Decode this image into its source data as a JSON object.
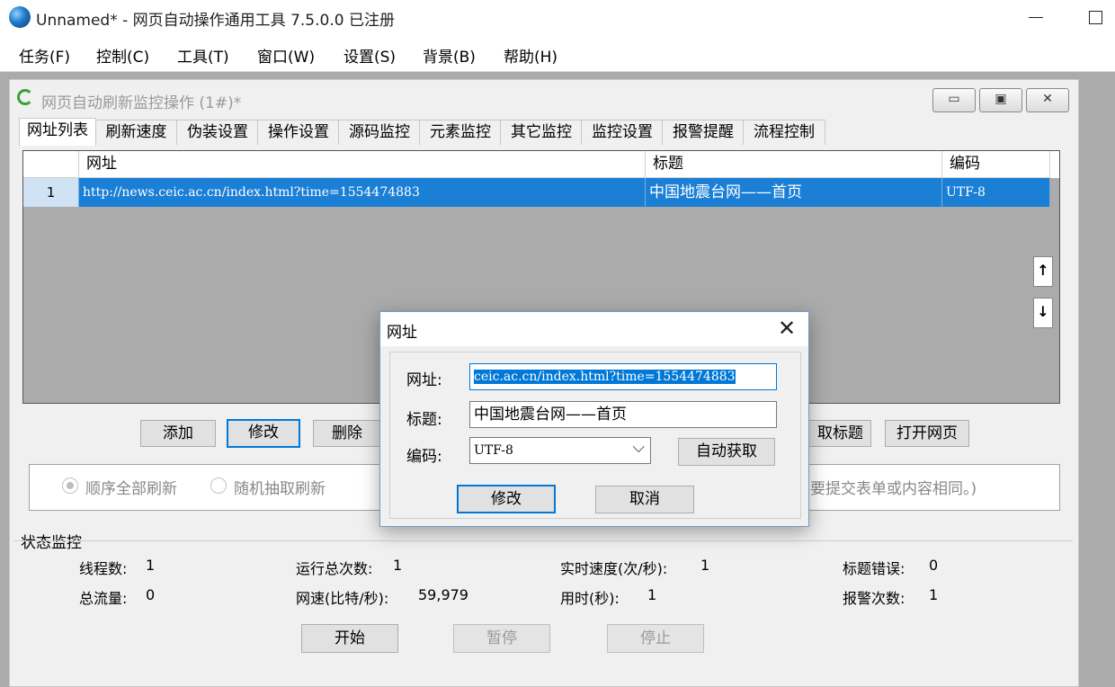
{
  "window": {
    "title": "Unnamed* - 网页自动操作通用工具 7.5.0.0  已注册"
  },
  "menu": [
    "任务(F)",
    "控制(C)",
    "工具(T)",
    "窗口(W)",
    "设置(S)",
    "背景(B)",
    "帮助(H)"
  ],
  "child": {
    "title": "网页自动刷新监控操作 (1#)*",
    "tabs": [
      "网址列表",
      "刷新速度",
      "伪装设置",
      "操作设置",
      "源码监控",
      "元素监控",
      "其它监控",
      "监控设置",
      "报警提醒",
      "流程控制"
    ],
    "active_tab": 0,
    "grid": {
      "columns": [
        "网址",
        "标题",
        "编码"
      ],
      "rows": [
        {
          "num": "1",
          "url": "http://news.ceic.ac.cn/index.html?time=1554474883",
          "title": "中国地震台网——首页",
          "encoding": "UTF-8"
        }
      ]
    },
    "buttons": {
      "add": "添加",
      "modify": "修改",
      "delete": "删除",
      "get_title": "取标题",
      "open_page": "打开网页"
    },
    "options": {
      "seq": "顺序全部刷新",
      "random": "随机抽取刷新",
      "note": "要提交表单或内容相同。)"
    },
    "status": {
      "title": "状态监控",
      "threads_label": "线程数:",
      "threads": "1",
      "total_runs_label": "运行总次数:",
      "total_runs": "1",
      "speed_label": "实时速度(次/秒):",
      "speed": "1",
      "title_err_label": "标题错误:",
      "title_err": "0",
      "traffic_label": "总流量:",
      "traffic": "0",
      "netspeed_label": "网速(比特/秒):",
      "netspeed": "59,979",
      "elapsed_label": "用时(秒):",
      "elapsed": "1",
      "alarms_label": "报警次数:",
      "alarms": "1"
    },
    "controls": {
      "start": "开始",
      "pause": "暂停",
      "stop": "停止"
    }
  },
  "dialog": {
    "title": "网址",
    "url_label": "网址:",
    "url_value": "ceic.ac.cn/index.html?time=1554474883",
    "title_label": "标题:",
    "title_value": "中国地震台网——首页",
    "encoding_label": "编码:",
    "encoding_value": "UTF-8",
    "auto_button": "自动获取",
    "ok_button": "修改",
    "cancel_button": "取消"
  },
  "icons": {
    "app": "globe-icon",
    "child": "refresh-icon",
    "close": "close-icon"
  },
  "colors": {
    "selection": "#1b7fd6",
    "focus": "#0078d7"
  }
}
